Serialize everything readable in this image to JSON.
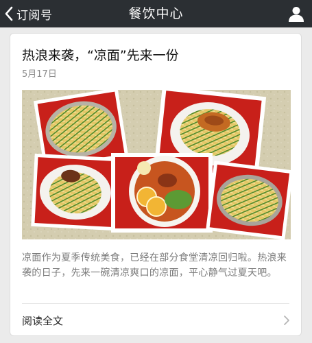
{
  "nav": {
    "back_label": "订阅号",
    "title": "餐饮中心",
    "back_icon": "chevron-left-icon",
    "profile_icon": "person-icon"
  },
  "article": {
    "title": "热浪来袭，“凉面”先来一份",
    "date": "5月17日",
    "summary": "凉面作为夏季传统美食，已经在部分食堂清凉回归啦。热浪来袭的日子，先来一碗清凉爽口的凉面，平心静气过夏天吧。",
    "read_more": "阅读全文",
    "read_more_icon": "chevron-right-icon"
  },
  "colors": {
    "navbar": "#2b2f33",
    "collage_frame": "#c8201a",
    "background": "#ebebeb"
  }
}
